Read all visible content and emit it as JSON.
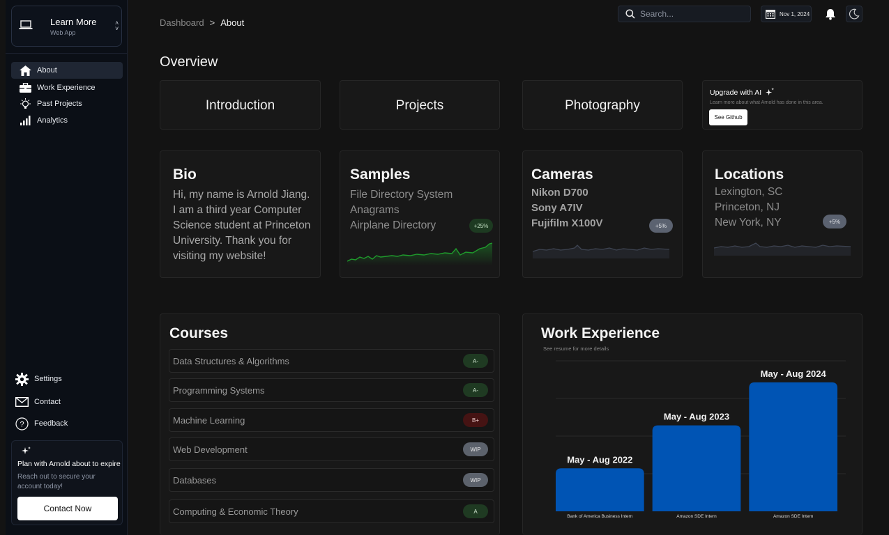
{
  "app": {
    "name": "Learn More",
    "subtitle": "Web App"
  },
  "nav": [
    {
      "label": "About",
      "icon": "home-icon",
      "active": true
    },
    {
      "label": "Work Experience",
      "icon": "briefcase-icon"
    },
    {
      "label": "Past Projects",
      "icon": "lightbulb-icon"
    },
    {
      "label": "Analytics",
      "icon": "signal-bars-icon"
    }
  ],
  "bottom_nav": [
    {
      "label": "Settings",
      "icon": "gear-icon"
    },
    {
      "label": "Contact",
      "icon": "mail-icon"
    },
    {
      "label": "Feedback",
      "icon": "help-circle-icon"
    }
  ],
  "plan": {
    "title": "Plan with Arnold about to expire",
    "subtitle": "Reach out to secure your account today!",
    "button": "Contact Now"
  },
  "breadcrumb": {
    "parent": "Dashboard",
    "separator": ">",
    "current": "About"
  },
  "search": {
    "placeholder": "Search..."
  },
  "date": "Nov 1, 2024",
  "overview_title": "Overview",
  "tiles": [
    "Introduction",
    "Projects",
    "Photography"
  ],
  "upgrade": {
    "title": "Upgrade with AI",
    "description": "Learn more about what Arnold has done in this area.",
    "button": "See Github"
  },
  "bio": {
    "title": "Bio",
    "text": "Hi, my name is Arnold Jiang. I am a third year Computer Science student at Princeton University. Thank you for visiting my website!"
  },
  "samples": {
    "title": "Samples",
    "items": [
      "File Directory System",
      "Anagrams",
      "Airplane Directory"
    ],
    "badge": "+25%"
  },
  "cameras": {
    "title": "Cameras",
    "items": [
      "Nikon D700",
      "Sony A7IV",
      "Fujifilm X100V"
    ],
    "badge": "+5%"
  },
  "locations": {
    "title": "Locations",
    "items": [
      "Lexington, SC",
      "Princeton, NJ",
      "New York, NY"
    ],
    "badge": "+5%"
  },
  "courses": {
    "title": "Courses",
    "rows": [
      {
        "name": "Data Structures & Algorithms",
        "grade": "A-",
        "tone": "g"
      },
      {
        "name": "Programming Systems",
        "grade": "A-",
        "tone": "g"
      },
      {
        "name": "Machine Learning",
        "grade": "B+",
        "tone": "r"
      },
      {
        "name": "Web Development",
        "grade": "WIP",
        "tone": "w"
      },
      {
        "name": "Databases",
        "grade": "WIP",
        "tone": "w"
      },
      {
        "name": "Computing & Economic Theory",
        "grade": "A",
        "tone": "g"
      }
    ]
  },
  "work": {
    "title": "Work Experience",
    "subtitle": "See resume for more details"
  },
  "chart_data": {
    "type": "bar",
    "categories": [
      "Bank of America Business Intern",
      "Amazon SDE Intern",
      "Amazon SDE Intern"
    ],
    "data_labels": [
      "May - Aug 2022",
      "May - Aug 2023",
      "May - Aug 2024"
    ],
    "values": [
      1,
      2,
      3
    ],
    "ylim": [
      0,
      3.5
    ],
    "grid": true,
    "bar_color": "#0054b4"
  },
  "colors": {
    "bar": "#0054b4",
    "badge_green": "#1d3a21",
    "badge_gray": "#5b6270",
    "spark_green": "#1f9b2c"
  }
}
